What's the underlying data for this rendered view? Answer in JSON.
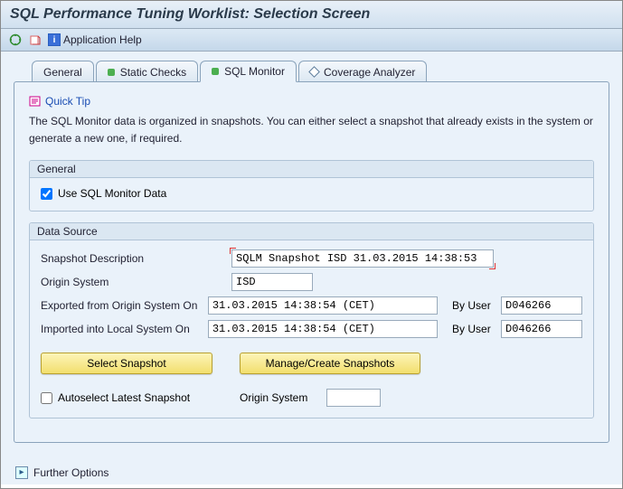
{
  "title": "SQL Performance Tuning Worklist: Selection Screen",
  "toolbar": {
    "app_help": "Application Help"
  },
  "tabs": {
    "general": "General",
    "static_checks": "Static Checks",
    "sql_monitor": "SQL Monitor",
    "coverage": "Coverage Analyzer"
  },
  "quicktip": {
    "label": "Quick Tip"
  },
  "description": "The SQL Monitor data is organized in snapshots. You can either select a snapshot that already exists in the system or generate a new one, if required.",
  "group_general": {
    "title": "General",
    "use_sql_monitor": "Use SQL Monitor Data"
  },
  "group_datasource": {
    "title": "Data Source",
    "snapshot_desc_label": "Snapshot Description",
    "snapshot_desc_value": "SQLM Snapshot ISD 31.03.2015 14:38:53",
    "origin_system_label": "Origin System",
    "origin_system_value": "ISD",
    "exported_label": "Exported from Origin System On",
    "exported_value": "31.03.2015 14:38:54 (CET)",
    "exported_user": "D046266",
    "imported_label": "Imported into Local System On",
    "imported_value": "31.03.2015 14:38:54 (CET)",
    "imported_user": "D046266",
    "by_user": "By User",
    "btn_select": "Select Snapshot",
    "btn_manage": "Manage/Create Snapshots",
    "autoselect": "Autoselect Latest Snapshot",
    "origin_system2_label": "Origin System",
    "origin_system2_value": ""
  },
  "further_options": "Further Options"
}
